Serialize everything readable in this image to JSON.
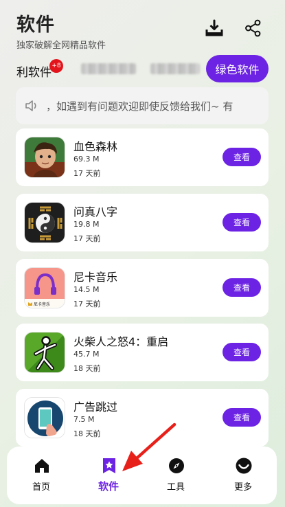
{
  "header": {
    "title": "软件",
    "subtitle": "独家破解全网精品软件",
    "download_icon": "download-tray-icon",
    "share_icon": "share-icon"
  },
  "tabs": {
    "active_label": "利软件",
    "badge": "+8",
    "green_button": "绿色软件"
  },
  "notice": {
    "icon": "speaker-icon",
    "text": "，如遇到有问题欢迎即使反馈给我们~ 有"
  },
  "apps": [
    {
      "name": "血色森林",
      "size": "69.3 M",
      "date": "17 天前",
      "button": "查看",
      "icon": "game-character-icon"
    },
    {
      "name": "问真八字",
      "size": "19.8 M",
      "date": "17 天前",
      "button": "查看",
      "icon": "yin-yang-bagua-icon"
    },
    {
      "name": "尼卡音乐",
      "size": "14.5 M",
      "date": "17 天前",
      "button": "查看",
      "icon": "headphones-icon",
      "icon_caption": "尼卡音乐"
    },
    {
      "name": "火柴人之怒4：重启",
      "size": "45.7 M",
      "date": "18 天前",
      "button": "查看",
      "icon": "stickman-icon"
    },
    {
      "name": "广告跳过",
      "size": "7.5 M",
      "date": "18 天前",
      "button": "查看",
      "icon": "phone-tap-icon"
    }
  ],
  "nav": [
    {
      "label": "首页",
      "icon": "home-icon"
    },
    {
      "label": "软件",
      "icon": "star-bookmark-icon",
      "active": true
    },
    {
      "label": "工具",
      "icon": "compass-icon"
    },
    {
      "label": "更多",
      "icon": "smile-icon"
    }
  ],
  "colors": {
    "accent": "#6c23e3",
    "badge": "#e3141b",
    "arrow": "#e8201a"
  }
}
